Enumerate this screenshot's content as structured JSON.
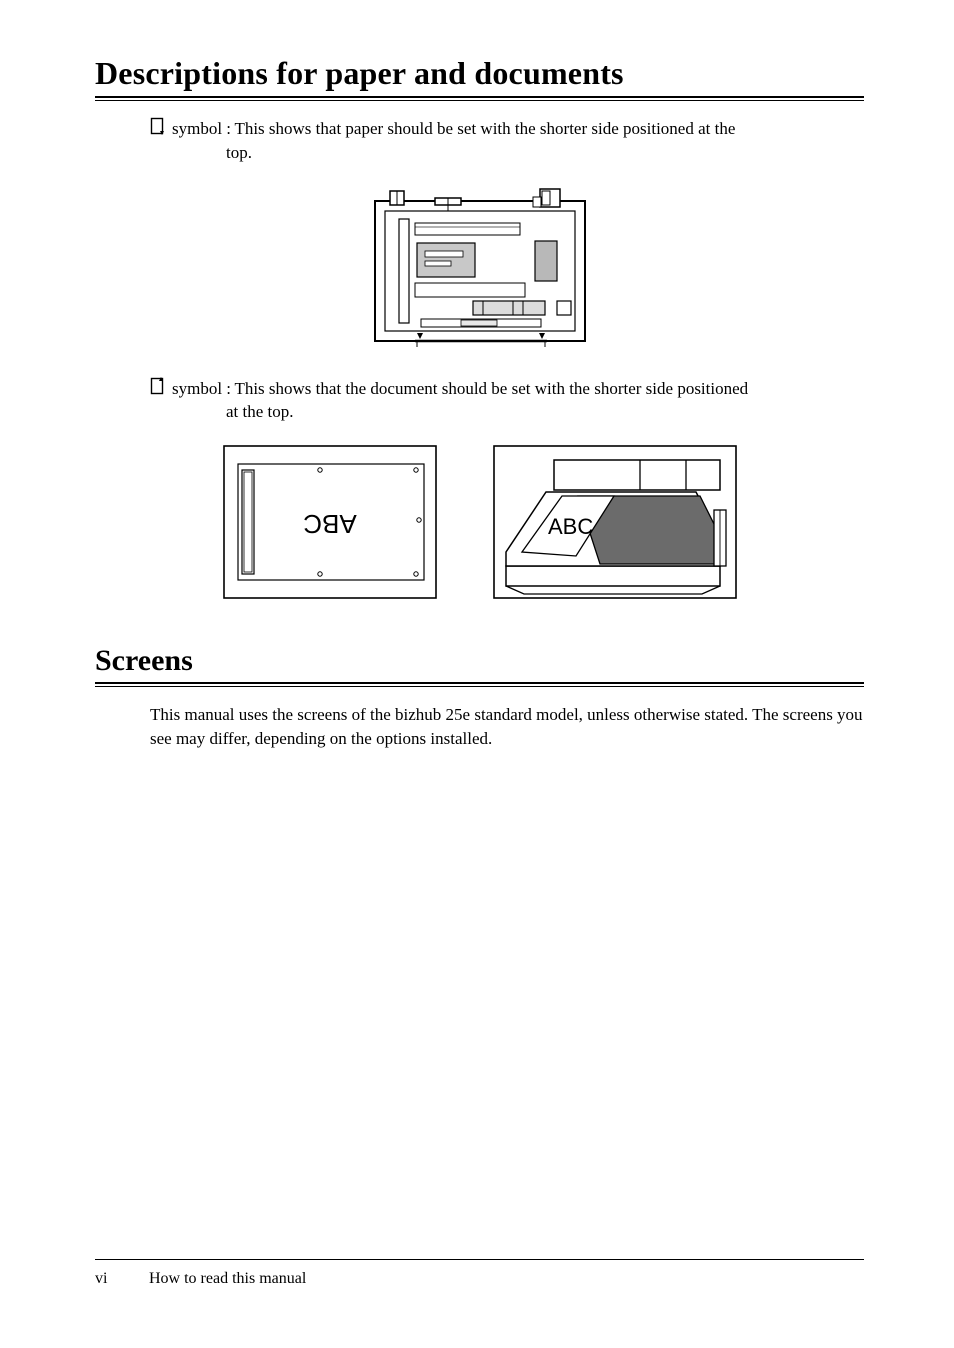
{
  "section1": {
    "title": "Descriptions for paper and documents",
    "para1_main": " symbol : This shows that paper should be set with the shorter side positioned at the",
    "para1_cont": "top.",
    "para2_main": " symbol : This shows that the document should be set with the shorter side positioned",
    "para2_cont": "at the top."
  },
  "section2": {
    "title": "Screens",
    "body": "This manual uses the screens of the bizhub 25e standard model, unless otherwise stated. The screens you see may differ, depending on the options installed."
  },
  "footer": {
    "page": "vi",
    "chapter": "How to read this manual"
  },
  "icons": {
    "paper_symbol": "paper-orientation-icon",
    "doc_symbol": "document-orientation-icon"
  },
  "figure_labels": {
    "adf_text": "ABC",
    "scanner_text": "ABC"
  }
}
